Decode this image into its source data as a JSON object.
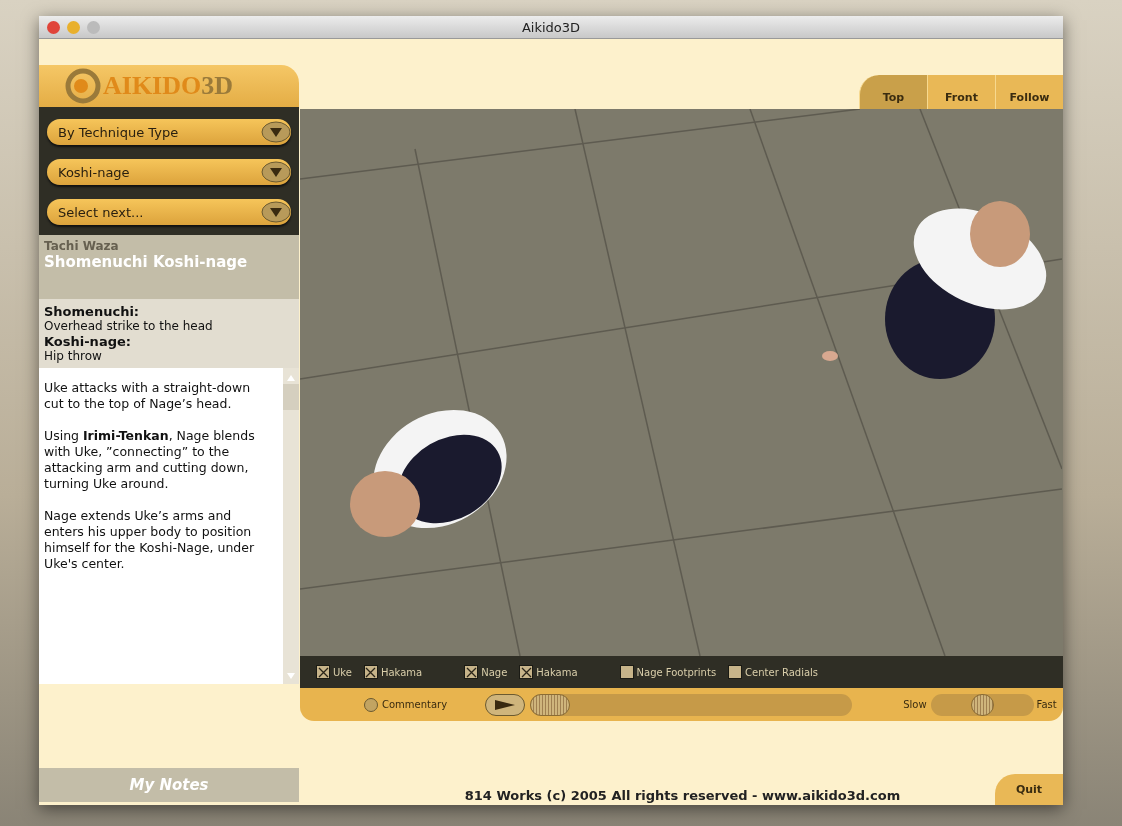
{
  "window": {
    "title": "Aikido3D"
  },
  "logo": {
    "text": "AIKIDO",
    "accent": "3D"
  },
  "view_tabs": [
    {
      "label": "Top",
      "selected": true
    },
    {
      "label": "Front",
      "selected": false
    },
    {
      "label": "Follow",
      "selected": false
    }
  ],
  "dropdowns": [
    {
      "value": "By Technique Type"
    },
    {
      "value": "Koshi-nage"
    },
    {
      "value": "Select next..."
    }
  ],
  "technique": {
    "category": "Tachi Waza",
    "name": "Shomenuchi Koshi-nage"
  },
  "glossary": [
    {
      "term": "Shomenuchi:",
      "definition": "Overhead strike to the head"
    },
    {
      "term": "Koshi-nage:",
      "definition": "Hip throw"
    }
  ],
  "description": [
    "Uke attacks with a straight-down cut to the top of Nage’s head.",
    "Using **Irimi-Tenkan**, Nage blends with Uke, ”connecting” to the attacking arm and cutting down, turning Uke around.",
    "Nage extends Uke’s arms and enters his upper body to position himself for the Koshi-Nage, under Uke's center."
  ],
  "display_options": [
    {
      "label": "Uke",
      "checked": true
    },
    {
      "label": "Hakama",
      "checked": true
    },
    {
      "label": "Nage",
      "checked": true
    },
    {
      "label": "Hakama",
      "checked": true
    },
    {
      "label": "Nage Footprints",
      "checked": false
    },
    {
      "label": "Center Radials",
      "checked": false
    }
  ],
  "commentary": {
    "label": "Commentary",
    "on": false
  },
  "playback": {
    "level": 0
  },
  "speed": {
    "slow_label": "Slow",
    "fast_label": "Fast",
    "level": 0.5
  },
  "notes_button": "My Notes",
  "footer": "814 Works (c) 2005 All rights reserved - www.aikido3d.com",
  "quit_button": "Quit"
}
